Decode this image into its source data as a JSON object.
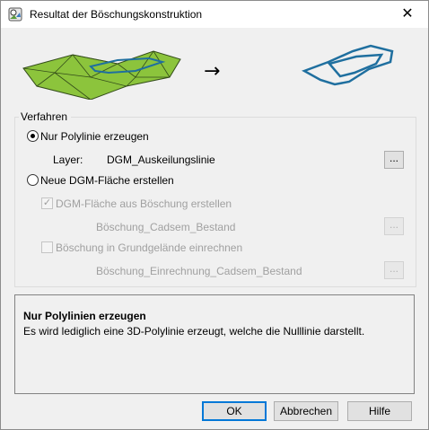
{
  "window": {
    "title": "Resultat der Böschungskonstruktion",
    "close_glyph": "✕"
  },
  "illustration": {
    "arrow": "→"
  },
  "group": {
    "label": "Verfahren",
    "option_polyline": "Nur Polylinie erzeugen",
    "layer_label": "Layer:",
    "layer_value": "DGM_Auskeilungslinie",
    "option_dgm": "Neue DGM-Fläche erstellen",
    "check_dgm_from_boeschung": "DGM-Fläche aus Böschung erstellen",
    "dgm_boeschung_value": "Böschung_Cadsem_Bestand",
    "check_ground": "Böschung in Grundgelände einrechnen",
    "ground_value": "Böschung_Einrechnung_Cadsem_Bestand",
    "dots": "..."
  },
  "info": {
    "title": "Nur Polylinien erzeugen",
    "text": "Es wird lediglich eine 3D-Polylinie erzeugt, welche die Nulllinie darstellt."
  },
  "buttons": {
    "ok": "OK",
    "cancel": "Abbrechen",
    "help": "Hilfe"
  },
  "colors": {
    "terrain_green": "#8cc43c",
    "polyline_blue": "#1f6f9f"
  }
}
